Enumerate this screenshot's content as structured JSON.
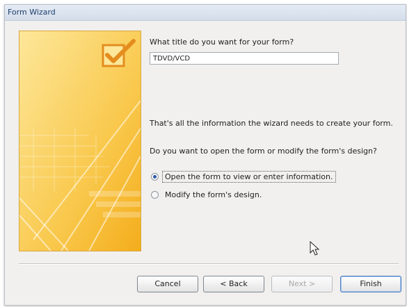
{
  "window": {
    "title": "Form Wizard"
  },
  "prompt": "What title do you want for your form?",
  "title_input": {
    "value": "TDVD/VCD"
  },
  "info_text": "That's all the information the wizard needs to create your form.",
  "question": "Do you want to open the form or modify the form's design?",
  "options": [
    {
      "label": "Open the form to view or enter information.",
      "selected": true
    },
    {
      "label": "Modify the form's design.",
      "selected": false
    }
  ],
  "buttons": {
    "cancel": "Cancel",
    "back": "< Back",
    "next": "Next >",
    "finish": "Finish"
  },
  "colors": {
    "art_light": "#fbe38c",
    "art_dark": "#f5b21f",
    "check": "#e48d1e",
    "accent": "#2f5ba8"
  },
  "icons": [
    "checkmark-icon",
    "mouse-cursor-icon"
  ]
}
